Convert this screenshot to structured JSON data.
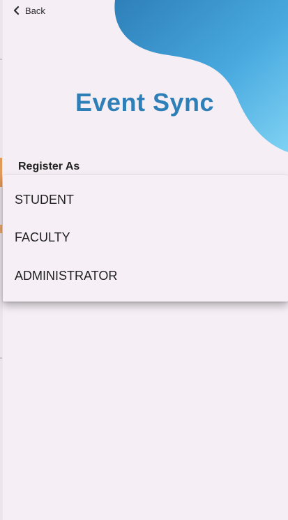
{
  "header": {
    "back_label": "Back"
  },
  "app": {
    "title": "Event Sync"
  },
  "form": {
    "register_label": "Register As",
    "role_options": [
      "STUDENT",
      "FACULTY",
      "ADMINISTRATOR"
    ]
  },
  "icons": {
    "back": "chevron-left-icon"
  },
  "colors": {
    "background": "#f5eff5",
    "title": "#2e7fb8",
    "blob_light": "#6cc8f0",
    "blob_dark": "#2e7fb8"
  }
}
